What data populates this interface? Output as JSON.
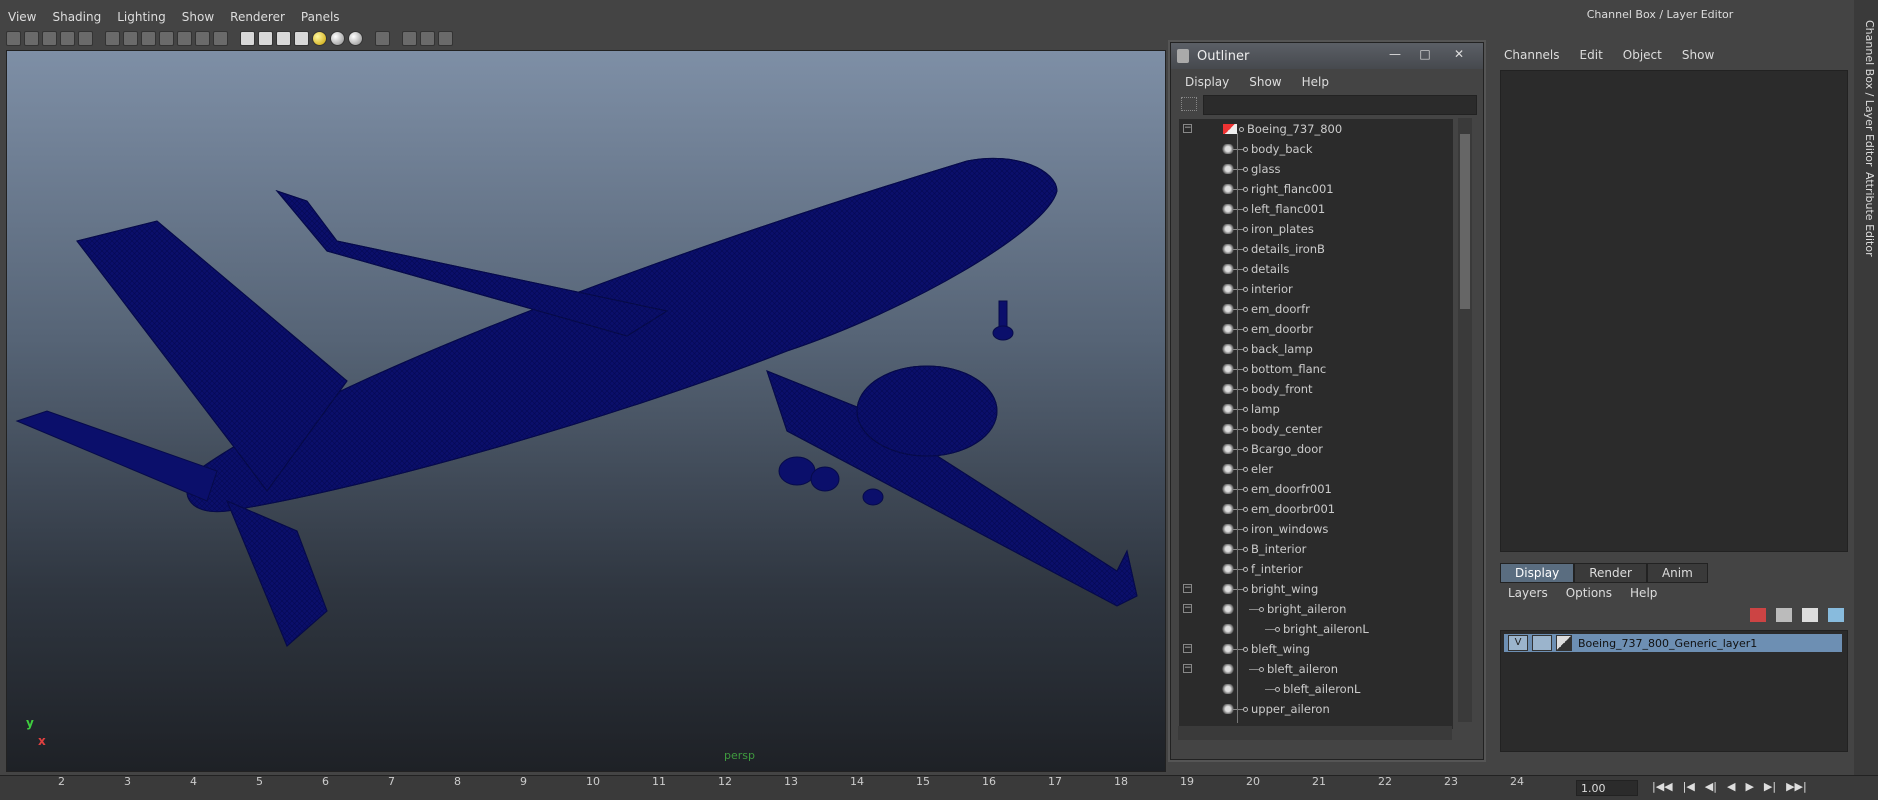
{
  "viewport": {
    "menu": [
      "View",
      "Shading",
      "Lighting",
      "Show",
      "Renderer",
      "Panels"
    ],
    "camera_label": "persp",
    "axis": {
      "y": "y",
      "x": "x"
    }
  },
  "outliner": {
    "title": "Outliner",
    "window_buttons": {
      "minimize": "—",
      "maximize": "□",
      "close": "✕"
    },
    "menu": [
      "Display",
      "Show",
      "Help"
    ],
    "items": [
      {
        "label": "Boeing_737_800",
        "depth": 0,
        "expander": "−"
      },
      {
        "label": "body_back",
        "depth": 1
      },
      {
        "label": "glass",
        "depth": 1
      },
      {
        "label": "right_flanc001",
        "depth": 1
      },
      {
        "label": "left_flanc001",
        "depth": 1
      },
      {
        "label": "iron_plates",
        "depth": 1
      },
      {
        "label": "details_ironB",
        "depth": 1
      },
      {
        "label": "details",
        "depth": 1
      },
      {
        "label": "interior",
        "depth": 1
      },
      {
        "label": "em_doorfr",
        "depth": 1
      },
      {
        "label": "em_doorbr",
        "depth": 1
      },
      {
        "label": "back_lamp",
        "depth": 1
      },
      {
        "label": "bottom_flanc",
        "depth": 1
      },
      {
        "label": "body_front",
        "depth": 1
      },
      {
        "label": "lamp",
        "depth": 1
      },
      {
        "label": "body_center",
        "depth": 1
      },
      {
        "label": "Bcargo_door",
        "depth": 1
      },
      {
        "label": "eler",
        "depth": 1
      },
      {
        "label": "em_doorfr001",
        "depth": 1
      },
      {
        "label": "em_doorbr001",
        "depth": 1
      },
      {
        "label": "iron_windows",
        "depth": 1
      },
      {
        "label": "B_interior",
        "depth": 1
      },
      {
        "label": "f_interior",
        "depth": 1
      },
      {
        "label": "bright_wing",
        "depth": 1,
        "expander": "−"
      },
      {
        "label": "bright_aileron",
        "depth": 2,
        "expander": "−"
      },
      {
        "label": "bright_aileronL",
        "depth": 3
      },
      {
        "label": "bleft_wing",
        "depth": 1,
        "expander": "−"
      },
      {
        "label": "bleft_aileron",
        "depth": 2,
        "expander": "−"
      },
      {
        "label": "bleft_aileronL",
        "depth": 3
      },
      {
        "label": "upper_aileron",
        "depth": 1
      }
    ]
  },
  "channel_box": {
    "title": "Channel Box / Layer Editor",
    "menu": [
      "Channels",
      "Edit",
      "Object",
      "Show"
    ],
    "layer_tabs": [
      "Display",
      "Render",
      "Anim"
    ],
    "layer_menu": [
      "Layers",
      "Options",
      "Help"
    ],
    "layer": {
      "visibility": "V",
      "name": "Boeing_737_800_Generic_layer1"
    },
    "side_tabs": [
      "Channel Box / Layer Editor",
      "Attribute Editor"
    ]
  },
  "timeline": {
    "ticks": [
      "2",
      "3",
      "4",
      "5",
      "6",
      "7",
      "8",
      "9",
      "10",
      "11",
      "12",
      "13",
      "14",
      "15",
      "16",
      "17",
      "18",
      "19",
      "20",
      "21",
      "22",
      "23",
      "24"
    ],
    "current_time": "1.00",
    "controls": [
      "|◀◀",
      "|◀",
      "◀|",
      "◀",
      "▶",
      "▶|",
      "▶▶|"
    ]
  },
  "colors": {
    "wireframe": "#0b0f6b",
    "layer_highlight": "#6d8fb3"
  }
}
